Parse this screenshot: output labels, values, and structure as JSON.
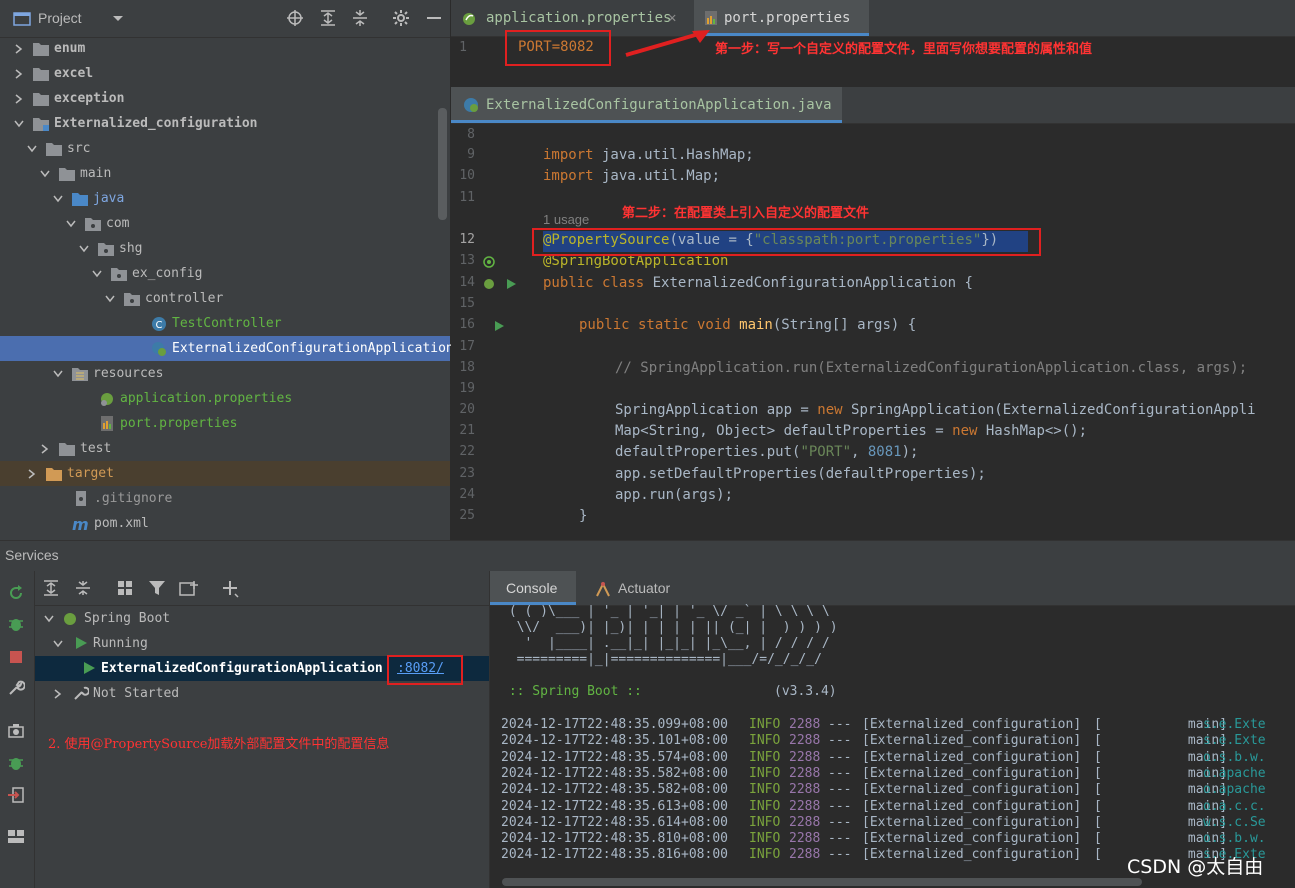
{
  "project_panel": {
    "title": "Project",
    "tree": [
      {
        "label": "enum",
        "icon": "folder-icon"
      },
      {
        "label": "excel",
        "icon": "folder-icon"
      },
      {
        "label": "exception",
        "icon": "folder-icon"
      },
      {
        "label": "Externalized_configuration",
        "icon": "module-folder-icon"
      },
      {
        "label": "src",
        "icon": "folder-icon"
      },
      {
        "label": "main",
        "icon": "folder-icon"
      },
      {
        "label": "java",
        "icon": "source-folder-icon"
      },
      {
        "label": "com",
        "icon": "package-icon"
      },
      {
        "label": "shg",
        "icon": "package-icon"
      },
      {
        "label": "ex_config",
        "icon": "package-icon"
      },
      {
        "label": "controller",
        "icon": "package-icon"
      },
      {
        "label": "TestController",
        "icon": "class-icon"
      },
      {
        "label": "ExternalizedConfigurationApplication",
        "icon": "spring-boot-class-icon"
      },
      {
        "label": "resources",
        "icon": "resources-folder-icon"
      },
      {
        "label": "application.properties",
        "icon": "spring-properties-icon"
      },
      {
        "label": "port.properties",
        "icon": "properties-file-icon"
      },
      {
        "label": "test",
        "icon": "folder-icon"
      },
      {
        "label": "target",
        "icon": "excluded-folder-icon"
      },
      {
        "label": ".gitignore",
        "icon": "gitignore-icon"
      },
      {
        "label": "pom.xml",
        "icon": "maven-icon"
      }
    ]
  },
  "editor_top": {
    "tabs": [
      {
        "label": "application.properties",
        "active": false
      },
      {
        "label": "port.properties",
        "active": true
      }
    ],
    "line_number": "1",
    "content": "PORT=8082",
    "annotation": "第一步：写一个自定义的配置文件，里面写你想要配置的属性和值"
  },
  "editor_bottom": {
    "tab": "ExternalizedConfigurationApplication.java",
    "usage_hint": "1 usage",
    "annotation": "第二步：在配置类上引入自定义的配置文件",
    "line_numbers": [
      "8",
      "9",
      "10",
      "11",
      "12",
      "13",
      "14",
      "15",
      "16",
      "17",
      "18",
      "19",
      "20",
      "21",
      "22",
      "23",
      "24",
      "25"
    ],
    "code": {
      "l9_kw": "import",
      "l9_rest": " java.util.HashMap;",
      "l10_kw": "import",
      "l10_rest": " java.util.Map;",
      "l12_ann": "@PropertySource",
      "l12_a": "(value = {",
      "l12_str": "\"classpath:port.properties\"",
      "l12_b": "})",
      "l13_ann": "@SpringBootApplication",
      "l14_kw": "public class",
      "l14_rest": " ExternalizedConfigurationApplication {",
      "l16_kw": "public static void",
      "l16_fn": " main",
      "l16_rest": "(String[] args) {",
      "l18_cmt": "// SpringApplication.run(ExternalizedConfigurationApplication.class, args);",
      "l20_a": "SpringApplication app = ",
      "l20_kw": "new",
      "l20_b": " SpringApplication(ExternalizedConfigurationAppli",
      "l21_a": "Map<String, Object> defaultProperties = ",
      "l21_kw": "new",
      "l21_b": " HashMap<>();",
      "l22_a": "defaultProperties.put(",
      "l22_str": "\"PORT\"",
      "l22_b": ", ",
      "l22_num": "8081",
      "l22_c": ");",
      "l23": "app.setDefaultProperties(defaultProperties);",
      "l24": "app.run(args);",
      "l25": "}"
    }
  },
  "services": {
    "title": "Services",
    "tree": {
      "spring_boot": "Spring Boot",
      "running": "Running",
      "app": "ExternalizedConfigurationApplication",
      "port_link": ":8082/",
      "not_started": "Not Started"
    },
    "annotation": "2. 使用@PropertySource加载外部配置文件中的配置信息"
  },
  "console": {
    "tabs": [
      "Console",
      "Actuator"
    ],
    "banner": [
      " ( ( )\\___ | '_ | '_| | '_ \\/ _` | \\ \\ \\ \\",
      "  \\\\/  ___)| |_)| | | | | || (_| |  ) ) ) )",
      "   '  |____| .__|_| |_|_| |_\\__, | / / / /",
      "  =========|_|==============|___/=/_/_/_/"
    ],
    "boot_label": " :: Spring Boot :: ",
    "boot_version": "(v3.3.4)",
    "log_rows": [
      {
        "ts": "2024-12-17T22:48:35.099+08:00",
        "level": "INFO",
        "pid": "2288",
        "sep": "---",
        "app": "[Externalized_configuration]",
        "thread": "[           main]",
        "logger": "s.e.Exte"
      },
      {
        "ts": "2024-12-17T22:48:35.101+08:00",
        "level": "INFO",
        "pid": "2288",
        "sep": "---",
        "app": "[Externalized_configuration]",
        "thread": "[           main]",
        "logger": "s.e.Exte"
      },
      {
        "ts": "2024-12-17T22:48:35.574+08:00",
        "level": "INFO",
        "pid": "2288",
        "sep": "---",
        "app": "[Externalized_configuration]",
        "thread": "[           main]",
        "logger": "o.s.b.w."
      },
      {
        "ts": "2024-12-17T22:48:35.582+08:00",
        "level": "INFO",
        "pid": "2288",
        "sep": "---",
        "app": "[Externalized_configuration]",
        "thread": "[           main]",
        "logger": "o.apache"
      },
      {
        "ts": "2024-12-17T22:48:35.582+08:00",
        "level": "INFO",
        "pid": "2288",
        "sep": "---",
        "app": "[Externalized_configuration]",
        "thread": "[           main]",
        "logger": "o.apache"
      },
      {
        "ts": "2024-12-17T22:48:35.613+08:00",
        "level": "INFO",
        "pid": "2288",
        "sep": "---",
        "app": "[Externalized_configuration]",
        "thread": "[           main]",
        "logger": "o.a.c.c."
      },
      {
        "ts": "2024-12-17T22:48:35.614+08:00",
        "level": "INFO",
        "pid": "2288",
        "sep": "---",
        "app": "[Externalized_configuration]",
        "thread": "[           main]",
        "logger": "w.s.c.Se"
      },
      {
        "ts": "2024-12-17T22:48:35.810+08:00",
        "level": "INFO",
        "pid": "2288",
        "sep": "---",
        "app": "[Externalized_configuration]",
        "thread": "[           main]",
        "logger": "o.s.b.w."
      },
      {
        "ts": "2024-12-17T22:48:35.816+08:00",
        "level": "INFO",
        "pid": "2288",
        "sep": "---",
        "app": "[Externalized_configuration]",
        "thread": "[           main]",
        "logger": "s.e.Exte"
      }
    ]
  },
  "watermark": "CSDN @太自由",
  "colors": {
    "annotation_red": "#e02020",
    "selection_blue": "#4b6eaf",
    "keyword": "#cc7832",
    "annotation": "#bbb529",
    "string": "#6a8759"
  }
}
